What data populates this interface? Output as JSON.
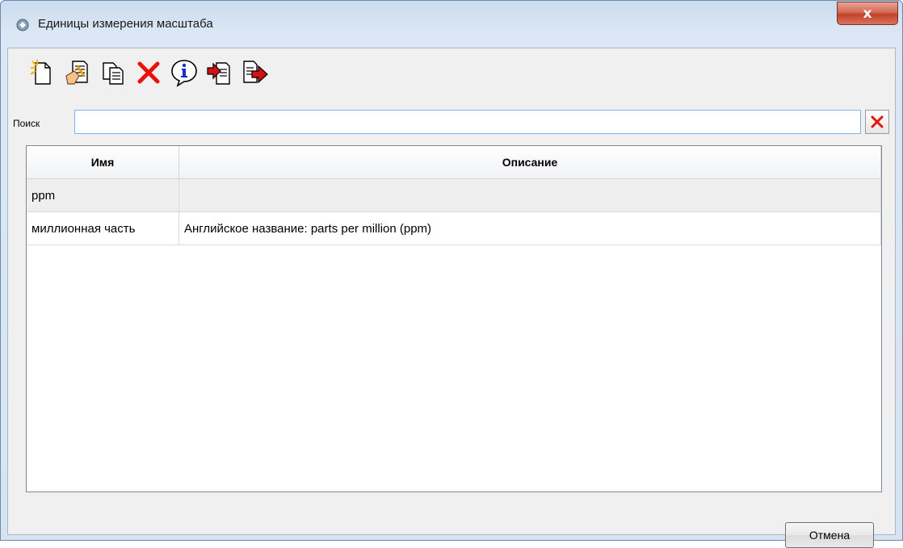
{
  "window": {
    "title": "Единицы измерения масштаба",
    "close_label": "x"
  },
  "toolbar": {
    "buttons": [
      {
        "icon": "new-document-icon"
      },
      {
        "icon": "edit-document-icon"
      },
      {
        "icon": "copy-icon"
      },
      {
        "icon": "delete-icon",
        "color": "#e8120c"
      },
      {
        "icon": "info-icon",
        "color": "#1530c8"
      },
      {
        "icon": "import-icon"
      },
      {
        "icon": "export-icon"
      }
    ]
  },
  "search": {
    "label": "Поиск",
    "value": "",
    "placeholder": ""
  },
  "table": {
    "columns": [
      "Имя",
      "Описание"
    ],
    "rows": [
      {
        "name": "ppm",
        "description": ""
      },
      {
        "name": "миллионная часть",
        "description": "Английское название: parts per million (ppm)"
      }
    ]
  },
  "footer": {
    "cancel_label": "Отмена"
  },
  "colors": {
    "accent": "#7eb4ea",
    "close": "#c2422a"
  }
}
